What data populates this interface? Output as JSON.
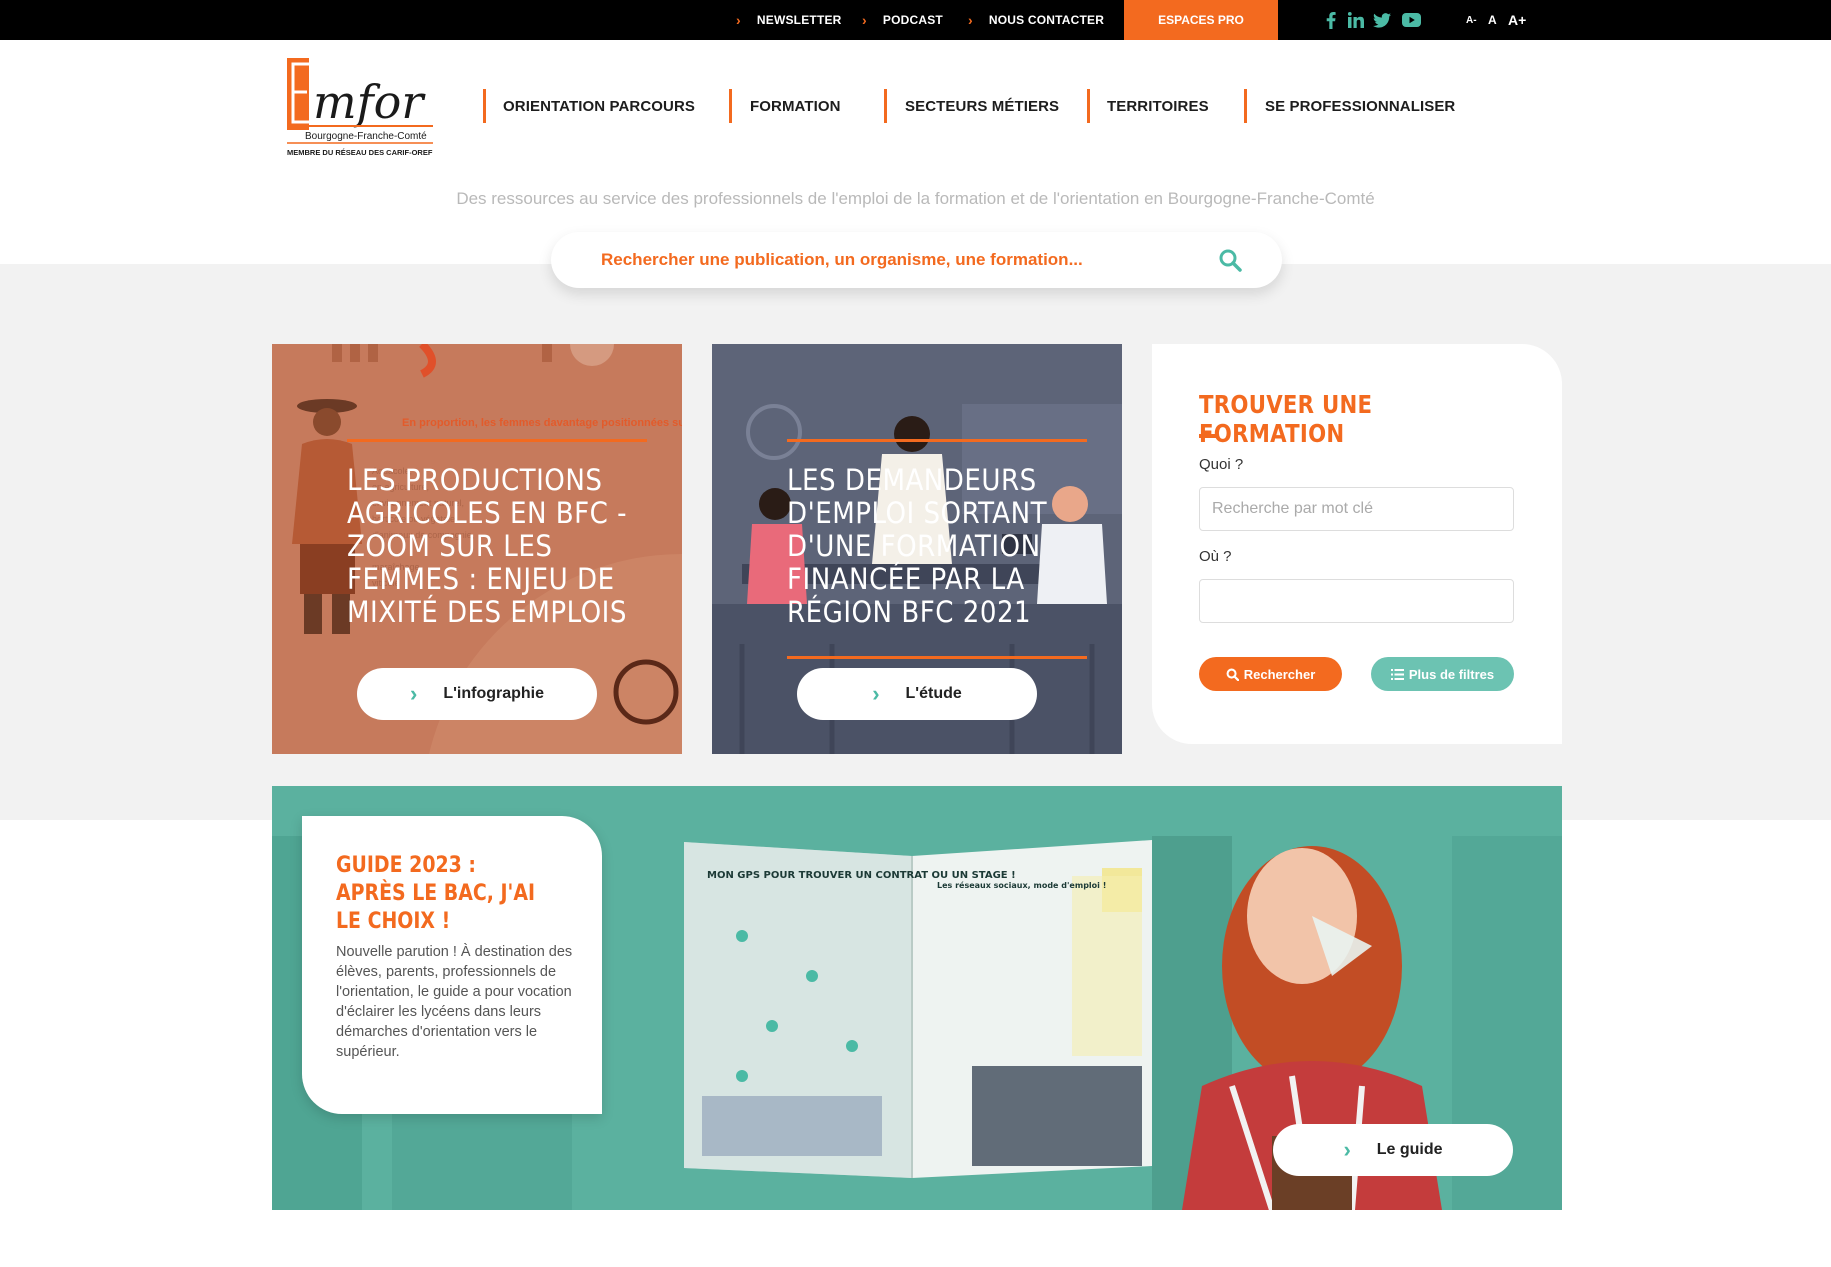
{
  "topbar": {
    "links": [
      "NEWSLETTER",
      "PODCAST",
      "NOUS CONTACTER"
    ],
    "espaces_pro": "ESPACES PRO",
    "social_icons": [
      "facebook-icon",
      "linkedin-icon",
      "twitter-icon",
      "youtube-icon"
    ],
    "font_sizes": [
      "A-",
      "A",
      "A+"
    ]
  },
  "logo": {
    "brand": "Emfor",
    "region": "Bourgogne-Franche-Comté",
    "member": "MEMBRE DU RÉSEAU DES CARIF-OREF"
  },
  "nav": [
    "ORIENTATION PARCOURS",
    "FORMATION",
    "SECTEURS MÉTIERS",
    "TERRITOIRES",
    "SE PROFESSIONNALISER"
  ],
  "tagline": "Des ressources au service des professionnels de l'emploi de la formation et de l'orientation en Bourgogne-Franche-Comté",
  "search": {
    "placeholder": "Rechercher une publication, un organisme, une formation..."
  },
  "cards": [
    {
      "title": "LES PRODUCTIONS AGRICOLES EN BFC - ZOOM SUR LES FEMMES : ENJEU DE MIXITÉ DES EMPLOIS",
      "button": "L'infographie",
      "bg_text_1": "En proportion, les femmes davantage positionnées sur certains métiers"
    },
    {
      "title": "LES DEMANDEURS D'EMPLOI SORTANT D'UNE FORMATION FINANCÉE PAR LA RÉGION BFC 2021",
      "button": "L'étude"
    }
  ],
  "formation": {
    "title": "TROUVER UNE FORMATION",
    "quoi_label": "Quoi ?",
    "quoi_placeholder": "Recherche par mot clé",
    "ou_label": "Où ?",
    "ou_placeholder": "",
    "search_button": "Rechercher",
    "filters_button": "Plus de filtres"
  },
  "guide": {
    "title": "GUIDE 2023 : APRÈS LE BAC, J'AI LE CHOIX !",
    "text": "Nouvelle parution ! À destination des élèves, parents, professionnels de l'orientation, le guide a pour vocation d'éclairer les lycéens dans leurs démarches d'orientation vers le supérieur.",
    "button": "Le guide",
    "book_heading": "MON GPS POUR TROUVER UN CONTRAT OU UN STAGE !",
    "book_heading_2": "Les réseaux sociaux, mode d'emploi !"
  },
  "colors": {
    "accent": "#f36a1f",
    "teal": "#5bb19f",
    "teal_light": "#6cc3b2",
    "card1_bg": "#c9785c",
    "card2_bg": "#5d6478"
  }
}
